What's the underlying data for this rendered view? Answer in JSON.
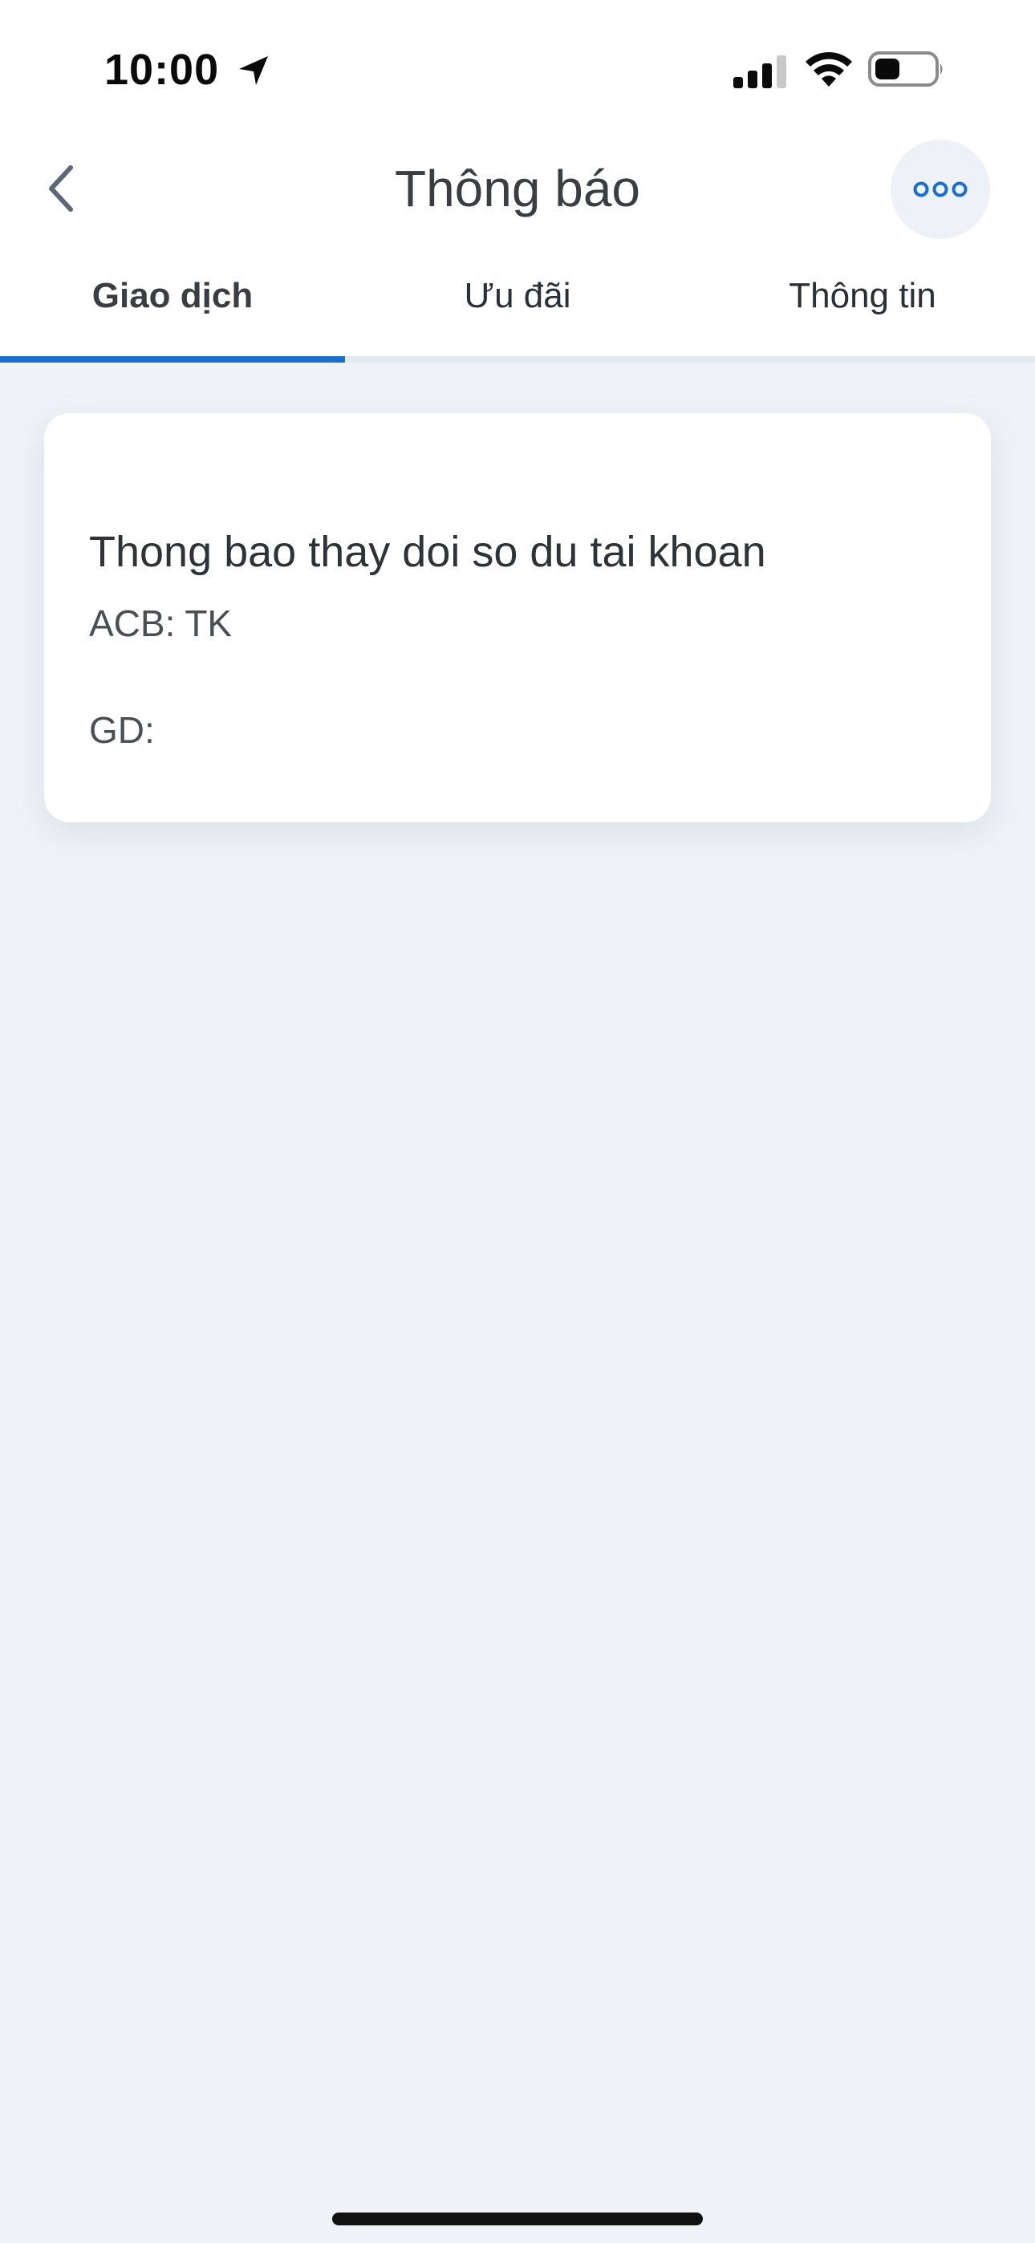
{
  "status_bar": {
    "time": "10:00",
    "icons": [
      "location-arrow-icon",
      "cellular-signal-icon",
      "wifi-icon",
      "battery-icon"
    ]
  },
  "header": {
    "title": "Thông báo",
    "back_icon": "chevron-left-icon",
    "more_icon": "more-dots-icon"
  },
  "tabs": [
    {
      "label": "Giao dịch",
      "active": true
    },
    {
      "label": "Ưu đãi",
      "active": false
    },
    {
      "label": "Thông tin",
      "active": false
    }
  ],
  "notifications": [
    {
      "title": "Thong bao thay doi so du tai khoan",
      "line1": "ACB: TK",
      "line2": "GD:"
    }
  ],
  "colors": {
    "accent": "#1b6fca",
    "background": "#eff3f7",
    "card": "#ffffff",
    "more_button_bg": "#eef1f7"
  }
}
